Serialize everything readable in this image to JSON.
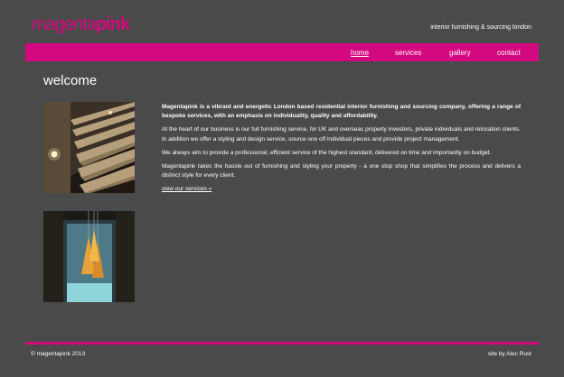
{
  "header": {
    "logo_part1": "magenta",
    "logo_part2": "pink",
    "tagline": "interior furnishing & sourcing london"
  },
  "nav": {
    "items": [
      {
        "label": "home"
      },
      {
        "label": "services"
      },
      {
        "label": "gallery"
      },
      {
        "label": "contact"
      }
    ]
  },
  "main": {
    "title": "welcome",
    "intro": "Magentapink is a vibrant and energetic London based residential interior furnishing and sourcing company, offering a range of bespoke services, with an emphasis on individuality, quality and affordability.",
    "para2": "At the heart of our business is our full furnishing service, for UK and overseas property investors, private individuals and relocation clients. In addition we offer a styling and design service, source one off individual pieces and provide project management.",
    "para3": "We always aim to provide a professional, efficient service of the highest standard, delivered on time and importantly on budget.",
    "para4": "Magentapink takes the hassle out of furnishing and styling your property - a one stop shop that simplifies the process and delivers a distinct style for every client.",
    "services_link": "view our services »"
  },
  "footer": {
    "copyright": "© magentapink 2013",
    "credit": "site by Alec Rust"
  },
  "colors": {
    "brand": "#d4087f",
    "background": "#4a4a4a"
  }
}
